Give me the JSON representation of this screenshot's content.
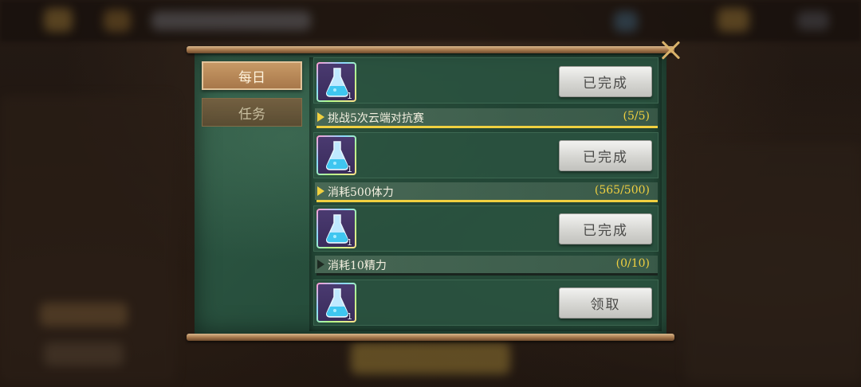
{
  "tabs": {
    "daily_label": "每日",
    "task_label": "任务"
  },
  "tasks": [
    {
      "reward_qty": "1",
      "button_label": "已完成"
    },
    {
      "name": "挑战5次云端对抗赛",
      "progress_text": "(5/5)",
      "progress": 1.0,
      "reward_qty": "1",
      "button_label": "已完成"
    },
    {
      "name": "消耗500体力",
      "progress_text": "(565/500)",
      "progress": 1.0,
      "reward_qty": "1",
      "button_label": "已完成"
    },
    {
      "name": "消耗10精力",
      "progress_text": "(0/10)",
      "progress": 0.0,
      "reward_qty": "1",
      "button_label": "领取"
    }
  ],
  "colors": {
    "board_green": "#2a5340",
    "progress_yellow": "#f0d040",
    "tab_active": "#b8875a"
  },
  "icons": {
    "close": "close-icon",
    "reward": "potion-flask-icon"
  }
}
